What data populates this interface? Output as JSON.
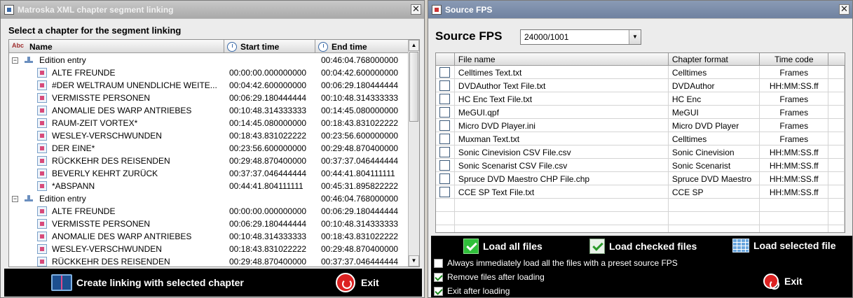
{
  "left_window": {
    "title": "Matroska XML chapter segment linking",
    "close_glyph": "✕",
    "prompt": "Select a chapter for the segment linking",
    "columns": {
      "name": "Name",
      "start": "Start time",
      "end": "End time"
    },
    "rows": [
      {
        "type": "edition",
        "name": "Edition entry",
        "start": "",
        "end": "00:46:04.768000000"
      },
      {
        "type": "chapter",
        "name": "ALTE FREUNDE",
        "start": "00:00:00.000000000",
        "end": "00:04:42.600000000"
      },
      {
        "type": "chapter",
        "name": "#DER WELTRAUM UNENDLICHE WEITE...",
        "start": "00:04:42.600000000",
        "end": "00:06:29.180444444"
      },
      {
        "type": "chapter",
        "name": "VERMISSTE PERSONEN",
        "start": "00:06:29.180444444",
        "end": "00:10:48.314333333"
      },
      {
        "type": "chapter",
        "name": "ANOMALIE DES WARP ANTRIEBES",
        "start": "00:10:48.314333333",
        "end": "00:14:45.080000000"
      },
      {
        "type": "chapter",
        "name": "RAUM-ZEIT VORTEX*",
        "start": "00:14:45.080000000",
        "end": "00:18:43.831022222"
      },
      {
        "type": "chapter",
        "name": "WESLEY-VERSCHWUNDEN",
        "start": "00:18:43.831022222",
        "end": "00:23:56.600000000"
      },
      {
        "type": "chapter",
        "name": "DER EINE*",
        "start": "00:23:56.600000000",
        "end": "00:29:48.870400000"
      },
      {
        "type": "chapter",
        "name": "RÜCKKEHR DES REISENDEN",
        "start": "00:29:48.870400000",
        "end": "00:37:37.046444444"
      },
      {
        "type": "chapter",
        "name": "BEVERLY KEHRT ZURÜCK",
        "start": "00:37:37.046444444",
        "end": "00:44:41.804111111"
      },
      {
        "type": "chapter",
        "name": "*ABSPANN",
        "start": "00:44:41.804111111",
        "end": "00:45:31.895822222"
      },
      {
        "type": "edition",
        "name": "Edition entry",
        "start": "",
        "end": "00:46:04.768000000"
      },
      {
        "type": "chapter",
        "name": "ALTE FREUNDE",
        "start": "00:00:00.000000000",
        "end": "00:06:29.180444444"
      },
      {
        "type": "chapter",
        "name": "VERMISSTE PERSONEN",
        "start": "00:06:29.180444444",
        "end": "00:10:48.314333333"
      },
      {
        "type": "chapter",
        "name": "ANOMALIE DES WARP ANTRIEBES",
        "start": "00:10:48.314333333",
        "end": "00:18:43.831022222"
      },
      {
        "type": "chapter",
        "name": "WESLEY-VERSCHWUNDEN",
        "start": "00:18:43.831022222",
        "end": "00:29:48.870400000"
      },
      {
        "type": "chapter",
        "name": "RÜCKKEHR DES REISENDEN",
        "start": "00:29:48.870400000",
        "end": "00:37:37.046444444"
      }
    ],
    "create_label": "Create linking with selected chapter",
    "exit_label": "Exit"
  },
  "right_window": {
    "title": "Source FPS",
    "close_glyph": "✕",
    "fps_label": "Source FPS",
    "fps_value": "24000/1001",
    "columns": {
      "file": "File name",
      "format": "Chapter format",
      "timecode": "Time code"
    },
    "files": [
      {
        "file": "Celltimes Text.txt",
        "format": "Celltimes",
        "timecode": "Frames"
      },
      {
        "file": "DVDAuthor Text File.txt",
        "format": "DVDAuthor",
        "timecode": "HH:MM:SS.ff"
      },
      {
        "file": "HC Enc Text File.txt",
        "format": "HC Enc",
        "timecode": "Frames"
      },
      {
        "file": "MeGUI.qpf",
        "format": "MeGUI",
        "timecode": "Frames"
      },
      {
        "file": "Micro DVD Player.ini",
        "format": "Micro DVD Player",
        "timecode": "Frames"
      },
      {
        "file": "Muxman Text.txt",
        "format": "Celltimes",
        "timecode": "Frames"
      },
      {
        "file": "Sonic Cinevision CSV File.csv",
        "format": "Sonic Cinevision",
        "timecode": "HH:MM:SS.ff"
      },
      {
        "file": "Sonic Scenarist CSV File.csv",
        "format": "Sonic Scenarist",
        "timecode": "HH:MM:SS.ff"
      },
      {
        "file": "Spruce DVD Maestro CHP File.chp",
        "format": "Spruce DVD Maestro",
        "timecode": "HH:MM:SS.ff"
      },
      {
        "file": "CCE SP Text File.txt",
        "format": "CCE SP",
        "timecode": "HH:MM:SS.ff"
      }
    ],
    "empty_rows": 3,
    "load_all": "Load all files",
    "load_checked": "Load checked files",
    "load_selected": "Load selected file",
    "options": [
      {
        "label": "Always immediately load all the files with a preset source FPS",
        "checked": false
      },
      {
        "label": "Remove files after loading",
        "checked": true
      },
      {
        "label": "Exit after loading",
        "checked": true
      }
    ],
    "exit_label": "Exit"
  }
}
